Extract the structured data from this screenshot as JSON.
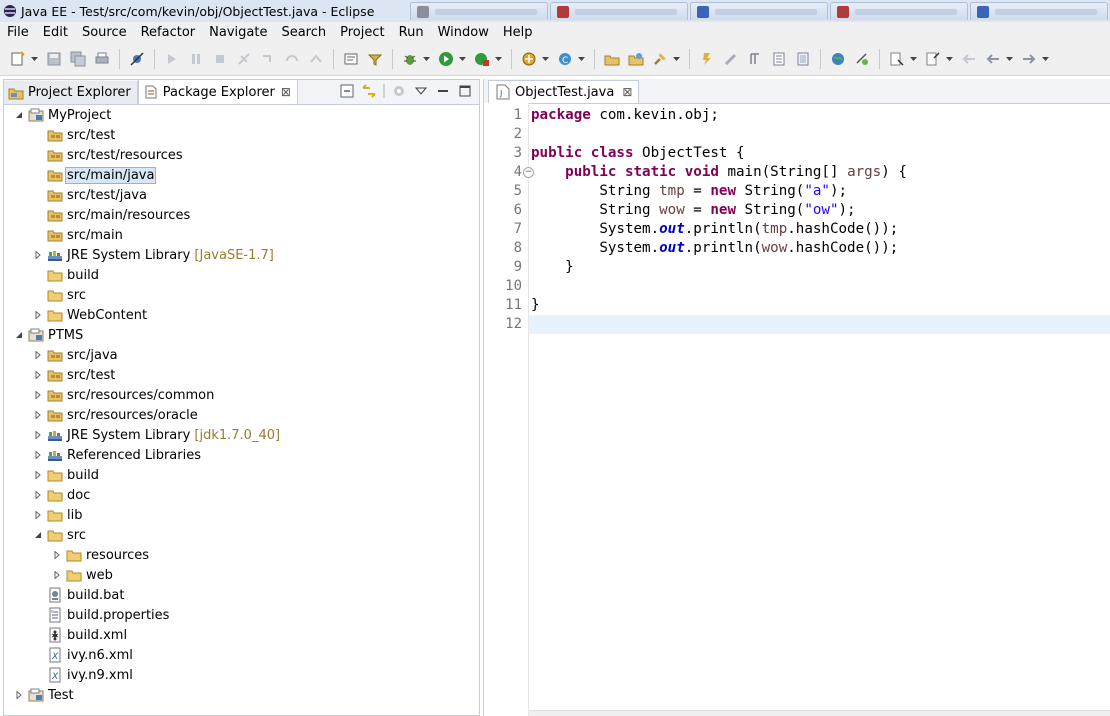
{
  "window": {
    "title": "Java EE - Test/src/com/kevin/obj/ObjectTest.java - Eclipse"
  },
  "menu": [
    "File",
    "Edit",
    "Source",
    "Refactor",
    "Navigate",
    "Search",
    "Project",
    "Run",
    "Window",
    "Help"
  ],
  "views": {
    "tabs": [
      {
        "label": "Project Explorer",
        "icon": "project-explorer-icon",
        "active": false
      },
      {
        "label": "Package Explorer",
        "icon": "package-explorer-icon",
        "active": true,
        "close": "⊠"
      }
    ]
  },
  "tree": [
    {
      "label": "MyProject",
      "level": 0,
      "expanded": true,
      "icon": "project-icon"
    },
    {
      "label": "src/test",
      "level": 1,
      "icon": "package-folder-icon"
    },
    {
      "label": "src/test/resources",
      "level": 1,
      "icon": "package-folder-icon"
    },
    {
      "label": "src/main/java",
      "level": 1,
      "icon": "package-folder-icon",
      "selected": true
    },
    {
      "label": "src/test/java",
      "level": 1,
      "icon": "package-folder-icon"
    },
    {
      "label": "src/main/resources",
      "level": 1,
      "icon": "package-folder-icon"
    },
    {
      "label": "src/main",
      "level": 1,
      "icon": "package-folder-icon"
    },
    {
      "label": "JRE System Library",
      "decoration": "[JavaSE-1.7]",
      "level": 1,
      "expandable": true,
      "icon": "library-icon"
    },
    {
      "label": "build",
      "level": 1,
      "icon": "folder-icon"
    },
    {
      "label": "src",
      "level": 1,
      "icon": "folder-icon"
    },
    {
      "label": "WebContent",
      "level": 1,
      "expandable": true,
      "icon": "folder-icon"
    },
    {
      "label": "PTMS",
      "level": 0,
      "expanded": true,
      "icon": "project-icon"
    },
    {
      "label": "src/java",
      "level": 1,
      "expandable": true,
      "icon": "package-folder-icon"
    },
    {
      "label": "src/test",
      "level": 1,
      "expandable": true,
      "icon": "package-folder-icon"
    },
    {
      "label": "src/resources/common",
      "level": 1,
      "expandable": true,
      "icon": "package-folder-icon"
    },
    {
      "label": "src/resources/oracle",
      "level": 1,
      "expandable": true,
      "icon": "package-folder-icon"
    },
    {
      "label": "JRE System Library",
      "decoration": "[jdk1.7.0_40]",
      "level": 1,
      "expandable": true,
      "icon": "library-icon"
    },
    {
      "label": "Referenced Libraries",
      "level": 1,
      "expandable": true,
      "icon": "library-icon"
    },
    {
      "label": "build",
      "level": 1,
      "expandable": true,
      "icon": "folder-icon"
    },
    {
      "label": "doc",
      "level": 1,
      "expandable": true,
      "icon": "folder-icon"
    },
    {
      "label": "lib",
      "level": 1,
      "expandable": true,
      "icon": "folder-icon"
    },
    {
      "label": "src",
      "level": 1,
      "expanded": true,
      "icon": "folder-icon"
    },
    {
      "label": "resources",
      "level": 2,
      "expandable": true,
      "icon": "folder-icon"
    },
    {
      "label": "web",
      "level": 2,
      "expandable": true,
      "icon": "folder-icon"
    },
    {
      "label": "build.bat",
      "level": 1,
      "icon": "bat-file-icon"
    },
    {
      "label": "build.properties",
      "level": 1,
      "icon": "properties-file-icon"
    },
    {
      "label": "build.xml",
      "level": 1,
      "icon": "ant-file-icon"
    },
    {
      "label": "ivy.n6.xml",
      "level": 1,
      "icon": "xml-file-icon"
    },
    {
      "label": "ivy.n9.xml",
      "level": 1,
      "icon": "xml-file-icon"
    },
    {
      "label": "Test",
      "level": 0,
      "expandable": true,
      "icon": "project-icon"
    }
  ],
  "editor": {
    "tab_label": "ObjectTest.java",
    "tab_close": "⊠",
    "line_numbers": [
      "1",
      "2",
      "3",
      "4",
      "5",
      "6",
      "7",
      "8",
      "9",
      "10",
      "11",
      "12"
    ],
    "current_line": 12,
    "lines": [
      [
        {
          "t": "package",
          "c": "kw"
        },
        {
          "t": " com.kevin.obj;",
          "c": ""
        }
      ],
      [],
      [
        {
          "t": "public",
          "c": "kw"
        },
        {
          "t": " ",
          "c": ""
        },
        {
          "t": "class",
          "c": "kw"
        },
        {
          "t": " ObjectTest {",
          "c": ""
        }
      ],
      [
        {
          "t": "    ",
          "c": ""
        },
        {
          "t": "public",
          "c": "kw"
        },
        {
          "t": " ",
          "c": ""
        },
        {
          "t": "static",
          "c": "kw"
        },
        {
          "t": " ",
          "c": ""
        },
        {
          "t": "void",
          "c": "kw"
        },
        {
          "t": " main(String[] ",
          "c": ""
        },
        {
          "t": "args",
          "c": "var"
        },
        {
          "t": ") {",
          "c": ""
        }
      ],
      [
        {
          "t": "        String ",
          "c": ""
        },
        {
          "t": "tmp",
          "c": "var"
        },
        {
          "t": " = ",
          "c": ""
        },
        {
          "t": "new",
          "c": "kw"
        },
        {
          "t": " String(",
          "c": ""
        },
        {
          "t": "\"a\"",
          "c": "str"
        },
        {
          "t": ");",
          "c": ""
        }
      ],
      [
        {
          "t": "        String ",
          "c": ""
        },
        {
          "t": "wow",
          "c": "var"
        },
        {
          "t": " = ",
          "c": ""
        },
        {
          "t": "new",
          "c": "kw"
        },
        {
          "t": " String(",
          "c": ""
        },
        {
          "t": "\"ow\"",
          "c": "str"
        },
        {
          "t": ");",
          "c": ""
        }
      ],
      [
        {
          "t": "        System.",
          "c": ""
        },
        {
          "t": "out",
          "c": "fld"
        },
        {
          "t": ".println(",
          "c": ""
        },
        {
          "t": "tmp",
          "c": "var"
        },
        {
          "t": ".hashCode());",
          "c": ""
        }
      ],
      [
        {
          "t": "        System.",
          "c": ""
        },
        {
          "t": "out",
          "c": "fld"
        },
        {
          "t": ".println(",
          "c": ""
        },
        {
          "t": "wow",
          "c": "var"
        },
        {
          "t": ".hashCode());",
          "c": ""
        }
      ],
      [
        {
          "t": "    }",
          "c": ""
        }
      ],
      [],
      [
        {
          "t": "}",
          "c": ""
        }
      ],
      []
    ]
  },
  "colors": {
    "keyword": "#7f0055",
    "string": "#2a00ff",
    "field": "#0000c0",
    "local_variable": "#6a3e3e",
    "current_line": "#e8f2fe",
    "selection": "#d7e7f7"
  }
}
